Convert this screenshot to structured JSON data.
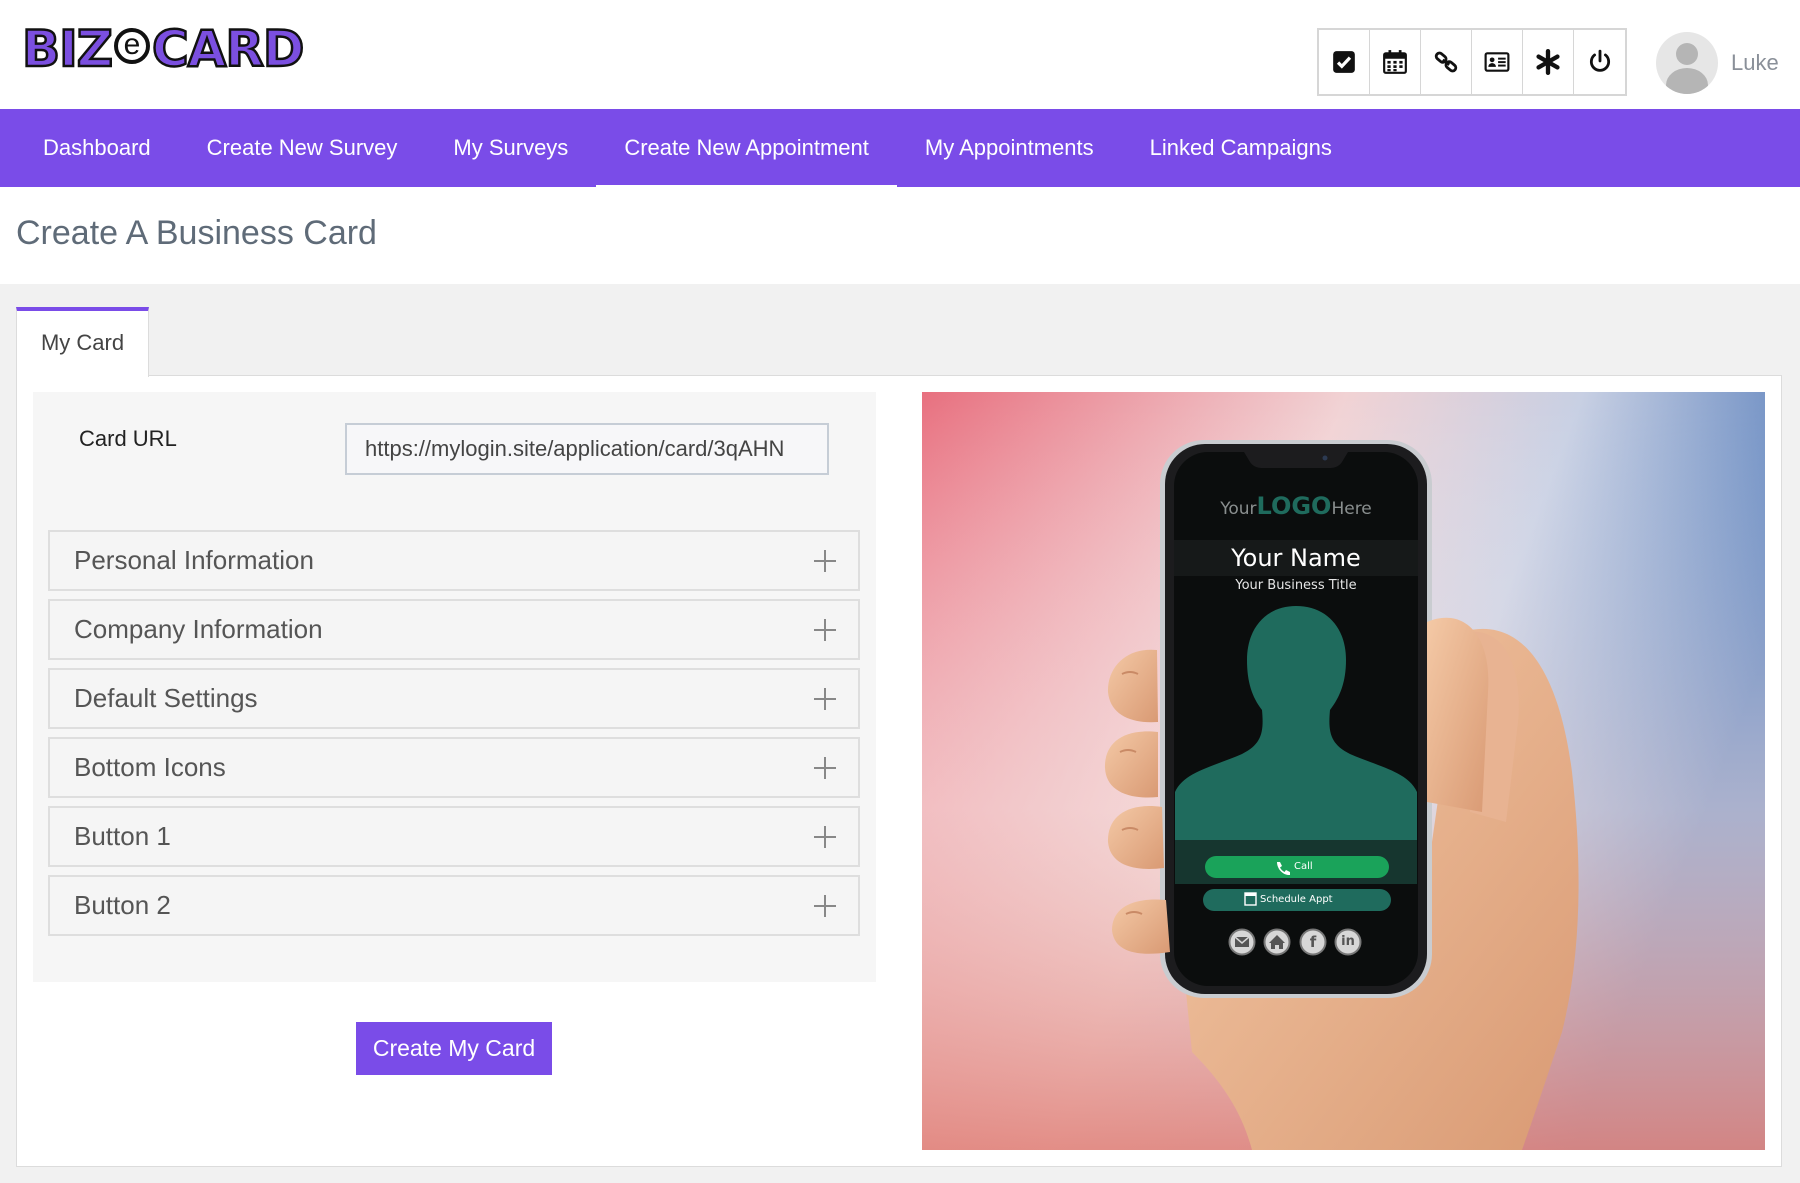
{
  "header": {
    "logo_text_left": "BIZ",
    "logo_text_mid": "e",
    "logo_text_right": "CARD",
    "toolbar_icons": [
      "check-square-icon",
      "calendar-icon",
      "link-icon",
      "id-card-icon",
      "asterisk-icon",
      "power-icon"
    ],
    "username": "Luke"
  },
  "nav": {
    "items": [
      {
        "label": "Dashboard"
      },
      {
        "label": "Create New Survey"
      },
      {
        "label": "My Surveys"
      },
      {
        "label": "Create New Appointment"
      },
      {
        "label": "My Appointments"
      },
      {
        "label": "Linked Campaigns"
      }
    ],
    "active_index": 3
  },
  "page": {
    "title": "Create A Business Card",
    "tab_label": "My Card"
  },
  "form": {
    "card_url_label": "Card URL",
    "card_url_value": "https://mylogin.site/application/card/3qAHN",
    "sections": [
      {
        "label": "Personal Information"
      },
      {
        "label": "Company Information"
      },
      {
        "label": "Default Settings"
      },
      {
        "label": "Bottom Icons"
      },
      {
        "label": "Button 1"
      },
      {
        "label": "Button 2"
      }
    ],
    "submit_label": "Create My Card"
  },
  "preview": {
    "logo_your": "Your",
    "logo_logo": "LOGO",
    "logo_here": "Here",
    "name": "Your Name",
    "title": "Your Business Title",
    "call_label": "Call",
    "schedule_label": "Schedule Appt",
    "bottom_icons": [
      "email-icon",
      "home-icon",
      "facebook-icon",
      "linkedin-icon"
    ],
    "linkedin_text": "in",
    "facebook_text": "f",
    "colors": {
      "card_bg": "#0b0d0d",
      "accent_green": "#1f6b5d",
      "call_button": "#1aa35a",
      "brand_purple": "#7a4ce8"
    }
  }
}
